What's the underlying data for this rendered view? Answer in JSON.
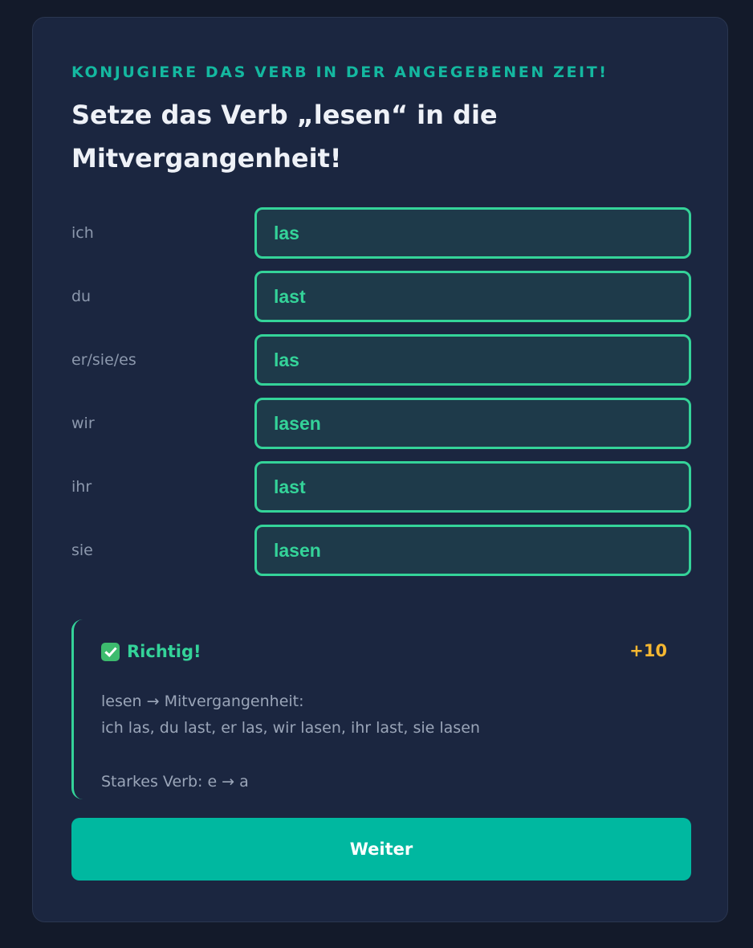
{
  "exercise": {
    "instruction": "KONJUGIERE DAS VERB IN DER ANGEGEBENEN ZEIT!",
    "title": "Setze das Verb „lesen“ in die Mitvergangenheit!"
  },
  "conjugation": {
    "rows": [
      {
        "pronoun": "ich",
        "answer": "las"
      },
      {
        "pronoun": "du",
        "answer": "last"
      },
      {
        "pronoun": "er/sie/es",
        "answer": "las"
      },
      {
        "pronoun": "wir",
        "answer": "lasen"
      },
      {
        "pronoun": "ihr",
        "answer": "last"
      },
      {
        "pronoun": "sie",
        "answer": "lasen"
      }
    ]
  },
  "feedback": {
    "icon": "check-box-icon",
    "status": "Richtig!",
    "points": "+10",
    "line1": "lesen → Mitvergangenheit:",
    "line2": "ich las, du last, er las, wir lasen, ihr last, sie lasen",
    "line3": "Starkes Verb: e → a"
  },
  "actions": {
    "next_label": "Weiter"
  },
  "colors": {
    "background": "#131a2a",
    "card": "#1b2640",
    "accent": "#14b8a0",
    "correct": "#34d399",
    "points": "#f5b731",
    "button": "#00b8a0"
  }
}
